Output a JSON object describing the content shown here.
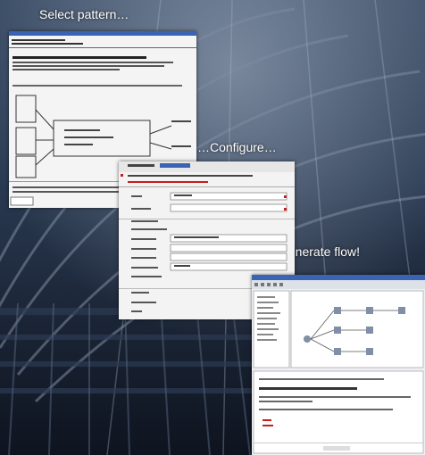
{
  "captions": {
    "select": "Select pattern…",
    "configure": "…Configure…",
    "generate": "…Generate flow!"
  },
  "colors": {
    "background": "#1d2a3c",
    "caption_text": "#ffffff",
    "window_bg": "#f3f3f3",
    "title_bar": "#3b63b3",
    "accent_red": "#c81b1b"
  }
}
